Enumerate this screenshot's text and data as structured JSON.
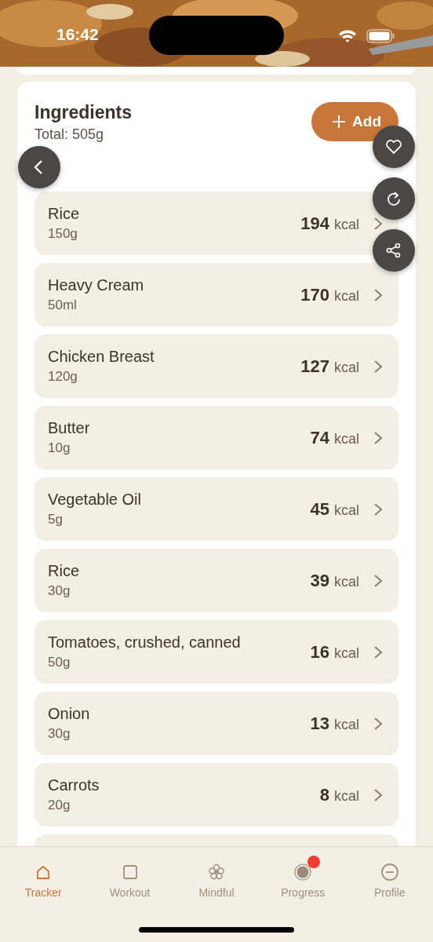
{
  "status_bar": {
    "time": "16:42"
  },
  "ingredients": {
    "title": "Ingredients",
    "total": "Total: 505g",
    "add_button": "Add",
    "items": [
      {
        "name": "Rice",
        "amount": "150g",
        "kcal": "194",
        "unit": "kcal"
      },
      {
        "name": "Heavy Cream",
        "amount": "50ml",
        "kcal": "170",
        "unit": "kcal"
      },
      {
        "name": "Chicken Breast",
        "amount": "120g",
        "kcal": "127",
        "unit": "kcal"
      },
      {
        "name": "Butter",
        "amount": "10g",
        "kcal": "74",
        "unit": "kcal"
      },
      {
        "name": "Vegetable Oil",
        "amount": "5g",
        "kcal": "45",
        "unit": "kcal"
      },
      {
        "name": "Rice",
        "amount": "30g",
        "kcal": "39",
        "unit": "kcal"
      },
      {
        "name": "Tomatoes, crushed, canned",
        "amount": "50g",
        "kcal": "16",
        "unit": "kcal"
      },
      {
        "name": "Onion",
        "amount": "30g",
        "kcal": "13",
        "unit": "kcal"
      },
      {
        "name": "Carrots",
        "amount": "20g",
        "kcal": "8",
        "unit": "kcal"
      }
    ]
  },
  "tabs": [
    {
      "label": "Tracker",
      "kind": "home",
      "selected": true,
      "badge": false
    },
    {
      "label": "Workout",
      "kind": "square",
      "selected": false,
      "badge": false
    },
    {
      "label": "Mindful",
      "kind": "flower",
      "selected": false,
      "badge": false
    },
    {
      "label": "Progress",
      "kind": "dot",
      "selected": false,
      "badge": true
    },
    {
      "label": "Profile",
      "kind": "minus",
      "selected": false,
      "badge": false
    }
  ]
}
